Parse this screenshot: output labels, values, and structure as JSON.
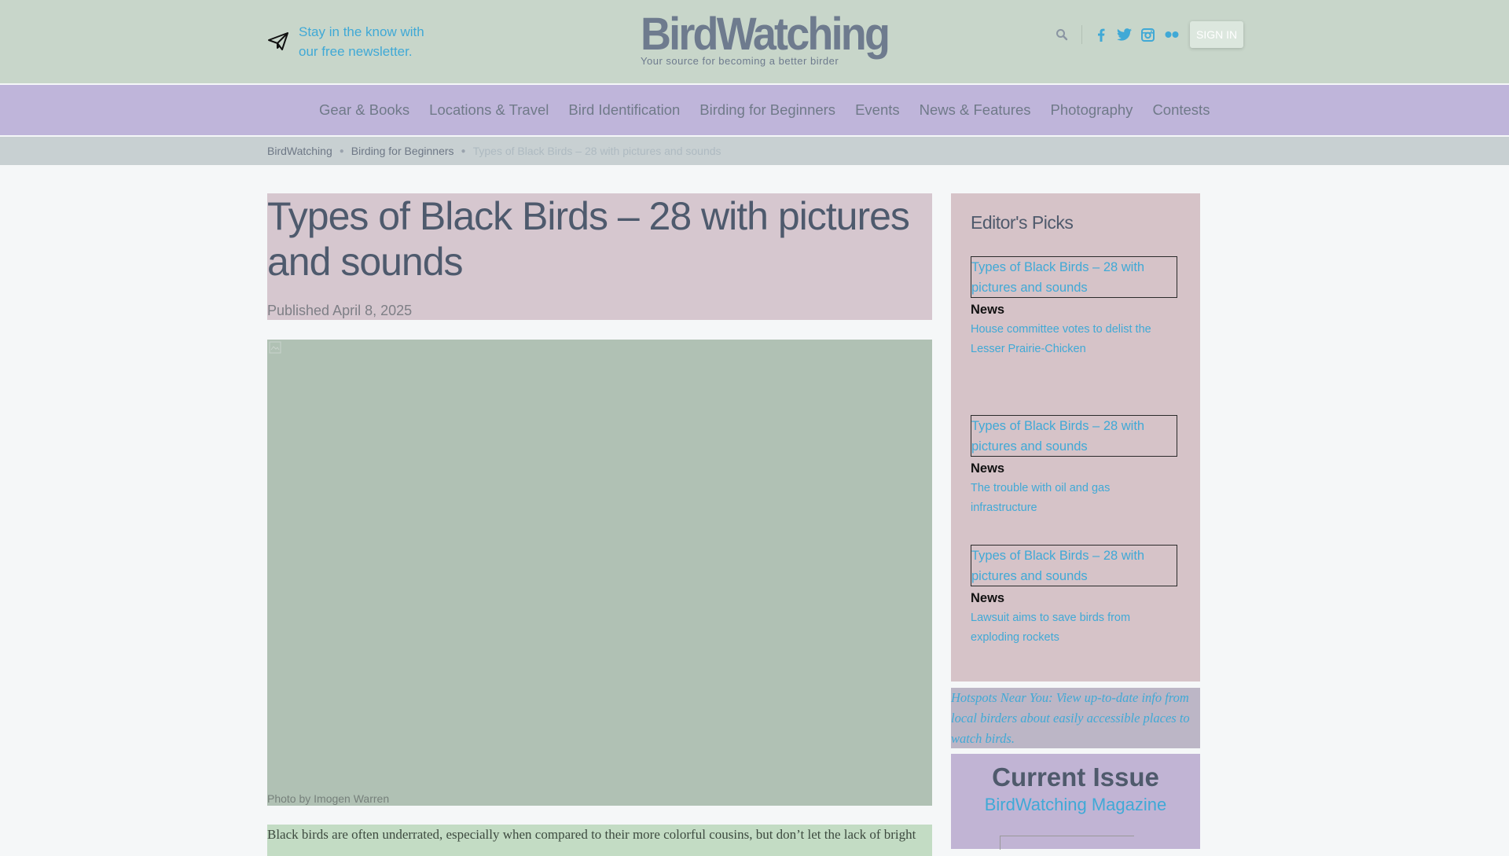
{
  "header": {
    "newsletter_line1": "Stay in the know with",
    "newsletter_line2": "our free newsletter.",
    "logo_wordmark": "BirdWatching",
    "logo_tagline": "Your source for becoming a better birder",
    "signin_label": "SIGN IN",
    "social_icons": [
      "facebook-icon",
      "twitter-icon",
      "instagram-icon",
      "flickr-icon"
    ]
  },
  "nav": {
    "items": [
      "Gear & Books",
      "Locations & Travel",
      "Bird Identification",
      "Birding for Beginners",
      "Events",
      "News & Features",
      "Photography",
      "Contests"
    ]
  },
  "breadcrumb": {
    "items": [
      "BirdWatching",
      "Birding for Beginners"
    ],
    "current": "Types of Black Birds – 28 with pictures and sounds"
  },
  "article": {
    "title": "Types of Black Birds – 28 with pictures and sounds",
    "published": "Published April 8, 2025",
    "photo_caption": "Photo by Imogen Warren",
    "intro": "Black birds are often underrated, especially when compared to their more colorful cousins, but don’t let the lack of bright"
  },
  "sidebar": {
    "title": "Editor's Picks",
    "picks": [
      {
        "thumb_alt": "Types of Black Birds – 28 with pictures and sounds",
        "category": "News",
        "headline": "House committee votes to delist the Lesser Prairie-Chicken"
      },
      {
        "thumb_alt": "Types of Black Birds – 28 with pictures and sounds",
        "category": "News",
        "headline": "The trouble with oil and gas infrastructure"
      },
      {
        "thumb_alt": "Types of Black Birds – 28 with pictures and sounds",
        "category": "News",
        "headline": "Lawsuit aims to save birds from exploding rockets"
      }
    ],
    "hotspots_alt": "Hotspots Near You: View up-to-date info from local birders about easily accessible places to watch birds.",
    "issue_title": "Current Issue",
    "issue_magazine": "BirdWatching Magazine"
  },
  "colors": {
    "header_bg": "#c8d6ca",
    "nav_bg": "#bfb5da",
    "link_blue": "#40a9d6",
    "heading_slate": "#4e5a6d"
  }
}
